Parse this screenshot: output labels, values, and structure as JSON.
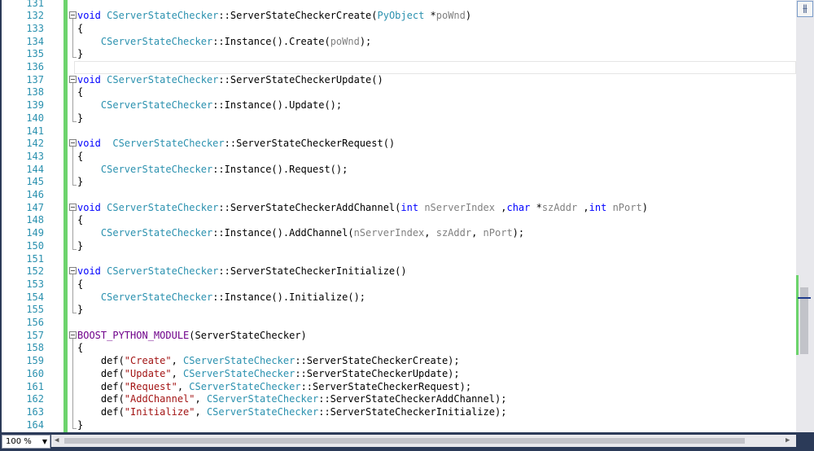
{
  "editor": {
    "zoom_label": "100 %",
    "split_icon": "split-window-icon",
    "lines": [
      {
        "n": "131",
        "segs": []
      },
      {
        "n": "132",
        "fold": true,
        "segs": [
          {
            "c": "kw",
            "t": "void"
          },
          {
            "c": "",
            "t": " "
          },
          {
            "c": "ty",
            "t": "CServerStateChecker"
          },
          {
            "c": "",
            "t": "::ServerStateCheckerCreate("
          },
          {
            "c": "ty",
            "t": "PyObject"
          },
          {
            "c": "",
            "t": " *"
          },
          {
            "c": "pa",
            "t": "poWnd"
          },
          {
            "c": "",
            "t": ")"
          }
        ]
      },
      {
        "n": "133",
        "segs": [
          {
            "c": "",
            "t": "{"
          }
        ]
      },
      {
        "n": "134",
        "segs": [
          {
            "c": "",
            "t": "    "
          },
          {
            "c": "ty",
            "t": "CServerStateChecker"
          },
          {
            "c": "",
            "t": "::Instance().Create("
          },
          {
            "c": "pa",
            "t": "poWnd"
          },
          {
            "c": "",
            "t": ");"
          }
        ]
      },
      {
        "n": "135",
        "segs": [
          {
            "c": "",
            "t": "}"
          }
        ]
      },
      {
        "n": "136",
        "segs": []
      },
      {
        "n": "137",
        "fold": true,
        "segs": [
          {
            "c": "kw",
            "t": "void"
          },
          {
            "c": "",
            "t": " "
          },
          {
            "c": "ty",
            "t": "CServerStateChecker"
          },
          {
            "c": "",
            "t": "::ServerStateCheckerUpdate()"
          }
        ]
      },
      {
        "n": "138",
        "segs": [
          {
            "c": "",
            "t": "{"
          }
        ]
      },
      {
        "n": "139",
        "segs": [
          {
            "c": "",
            "t": "    "
          },
          {
            "c": "ty",
            "t": "CServerStateChecker"
          },
          {
            "c": "",
            "t": "::Instance().Update();"
          }
        ]
      },
      {
        "n": "140",
        "segs": [
          {
            "c": "",
            "t": "}"
          }
        ]
      },
      {
        "n": "141",
        "segs": []
      },
      {
        "n": "142",
        "fold": true,
        "segs": [
          {
            "c": "kw",
            "t": "void"
          },
          {
            "c": "",
            "t": "  "
          },
          {
            "c": "ty",
            "t": "CServerStateChecker"
          },
          {
            "c": "",
            "t": "::ServerStateCheckerRequest()"
          }
        ]
      },
      {
        "n": "143",
        "segs": [
          {
            "c": "",
            "t": "{"
          }
        ]
      },
      {
        "n": "144",
        "segs": [
          {
            "c": "",
            "t": "    "
          },
          {
            "c": "ty",
            "t": "CServerStateChecker"
          },
          {
            "c": "",
            "t": "::Instance().Request();"
          }
        ]
      },
      {
        "n": "145",
        "segs": [
          {
            "c": "",
            "t": "}"
          }
        ]
      },
      {
        "n": "146",
        "segs": []
      },
      {
        "n": "147",
        "fold": true,
        "segs": [
          {
            "c": "kw",
            "t": "void"
          },
          {
            "c": "",
            "t": " "
          },
          {
            "c": "ty",
            "t": "CServerStateChecker"
          },
          {
            "c": "",
            "t": "::ServerStateCheckerAddChannel("
          },
          {
            "c": "kw",
            "t": "int"
          },
          {
            "c": "",
            "t": " "
          },
          {
            "c": "pa",
            "t": "nServerIndex"
          },
          {
            "c": "",
            "t": " ,"
          },
          {
            "c": "kw",
            "t": "char"
          },
          {
            "c": "",
            "t": " *"
          },
          {
            "c": "pa",
            "t": "szAddr"
          },
          {
            "c": "",
            "t": " ,"
          },
          {
            "c": "kw",
            "t": "int"
          },
          {
            "c": "",
            "t": " "
          },
          {
            "c": "pa",
            "t": "nPort"
          },
          {
            "c": "",
            "t": ")"
          }
        ]
      },
      {
        "n": "148",
        "segs": [
          {
            "c": "",
            "t": "{"
          }
        ]
      },
      {
        "n": "149",
        "segs": [
          {
            "c": "",
            "t": "    "
          },
          {
            "c": "ty",
            "t": "CServerStateChecker"
          },
          {
            "c": "",
            "t": "::Instance().AddChannel("
          },
          {
            "c": "pa",
            "t": "nServerIndex"
          },
          {
            "c": "",
            "t": ", "
          },
          {
            "c": "pa",
            "t": "szAddr"
          },
          {
            "c": "",
            "t": ", "
          },
          {
            "c": "pa",
            "t": "nPort"
          },
          {
            "c": "",
            "t": ");"
          }
        ]
      },
      {
        "n": "150",
        "segs": [
          {
            "c": "",
            "t": "}"
          }
        ]
      },
      {
        "n": "151",
        "segs": []
      },
      {
        "n": "152",
        "fold": true,
        "segs": [
          {
            "c": "kw",
            "t": "void"
          },
          {
            "c": "",
            "t": " "
          },
          {
            "c": "ty",
            "t": "CServerStateChecker"
          },
          {
            "c": "",
            "t": "::ServerStateCheckerInitialize()"
          }
        ]
      },
      {
        "n": "153",
        "segs": [
          {
            "c": "",
            "t": "{"
          }
        ]
      },
      {
        "n": "154",
        "segs": [
          {
            "c": "",
            "t": "    "
          },
          {
            "c": "ty",
            "t": "CServerStateChecker"
          },
          {
            "c": "",
            "t": "::Instance().Initialize();"
          }
        ]
      },
      {
        "n": "155",
        "segs": [
          {
            "c": "",
            "t": "}"
          }
        ]
      },
      {
        "n": "156",
        "segs": []
      },
      {
        "n": "157",
        "fold": true,
        "segs": [
          {
            "c": "mac",
            "t": "BOOST_PYTHON_MODULE"
          },
          {
            "c": "",
            "t": "(ServerStateChecker)"
          }
        ]
      },
      {
        "n": "158",
        "segs": [
          {
            "c": "",
            "t": "{"
          }
        ]
      },
      {
        "n": "159",
        "segs": [
          {
            "c": "",
            "t": "    def("
          },
          {
            "c": "st",
            "t": "\"Create\""
          },
          {
            "c": "",
            "t": ", "
          },
          {
            "c": "ty",
            "t": "CServerStateChecker"
          },
          {
            "c": "",
            "t": "::ServerStateCheckerCreate);"
          }
        ]
      },
      {
        "n": "160",
        "segs": [
          {
            "c": "",
            "t": "    def("
          },
          {
            "c": "st",
            "t": "\"Update\""
          },
          {
            "c": "",
            "t": ", "
          },
          {
            "c": "ty",
            "t": "CServerStateChecker"
          },
          {
            "c": "",
            "t": "::ServerStateCheckerUpdate);"
          }
        ]
      },
      {
        "n": "161",
        "segs": [
          {
            "c": "",
            "t": "    def("
          },
          {
            "c": "st",
            "t": "\"Request\""
          },
          {
            "c": "",
            "t": ", "
          },
          {
            "c": "ty",
            "t": "CServerStateChecker"
          },
          {
            "c": "",
            "t": "::ServerStateCheckerRequest);"
          }
        ]
      },
      {
        "n": "162",
        "segs": [
          {
            "c": "",
            "t": "    def("
          },
          {
            "c": "st",
            "t": "\"AddChannel\""
          },
          {
            "c": "",
            "t": ", "
          },
          {
            "c": "ty",
            "t": "CServerStateChecker"
          },
          {
            "c": "",
            "t": "::ServerStateCheckerAddChannel);"
          }
        ]
      },
      {
        "n": "163",
        "segs": [
          {
            "c": "",
            "t": "    def("
          },
          {
            "c": "st",
            "t": "\"Initialize\""
          },
          {
            "c": "",
            "t": ", "
          },
          {
            "c": "ty",
            "t": "CServerStateChecker"
          },
          {
            "c": "",
            "t": "::ServerStateCheckerInitialize);"
          }
        ]
      },
      {
        "n": "164",
        "segs": [
          {
            "c": "",
            "t": "}"
          }
        ]
      }
    ]
  },
  "colors": {
    "keyword": "#0000ff",
    "type": "#2b91af",
    "param": "#808080",
    "string": "#a31515",
    "macro": "#6f008a",
    "change_bar": "#6cd36c"
  }
}
